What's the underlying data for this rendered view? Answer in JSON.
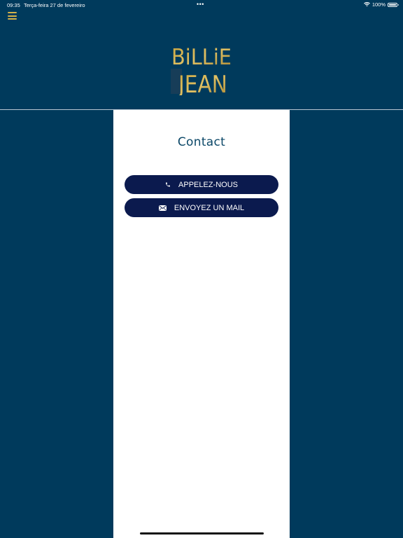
{
  "status_bar": {
    "time": "09:35",
    "date": "Terça-feira 27 de fevereiro",
    "dots": "•••",
    "battery_text": "100%"
  },
  "header": {
    "menu_icon": "hamburger-menu-icon",
    "logo_line1": "BiLLiE",
    "logo_line2": "JEAN"
  },
  "main": {
    "title": "Contact",
    "buttons": [
      {
        "label": "APPELEZ-NOUS",
        "icon": "phone-icon"
      },
      {
        "label": "ENVOYEZ UN MAIL",
        "icon": "mail-icon"
      }
    ]
  },
  "colors": {
    "background": "#003a5c",
    "accent_gold": "#d4b24a",
    "button_navy": "#0b1a4e",
    "title_blue": "#0c4868"
  }
}
